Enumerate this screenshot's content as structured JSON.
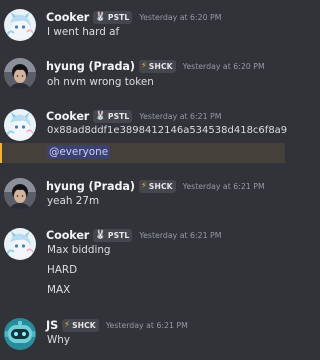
{
  "messages": [
    {
      "author": "Cooker",
      "role_tag": "PSTL",
      "role_icon": "bunny-icon",
      "timestamp": "Yesterday at 6:20 PM",
      "lines": [
        "I went hard af"
      ]
    },
    {
      "author": "hyung (Prada)",
      "role_tag": "SHCK",
      "role_icon": "lightning-icon",
      "timestamp": "Yesterday at 6:20 PM",
      "lines": [
        "oh nvm wrong token"
      ]
    },
    {
      "author": "Cooker",
      "role_tag": "PSTL",
      "role_icon": "bunny-icon",
      "timestamp": "Yesterday at 6:21 PM",
      "lines": [
        "0x88ad8ddf1e3898412146a534538d418c6f8a9"
      ],
      "mention": "@everyone"
    },
    {
      "author": "hyung (Prada)",
      "role_tag": "SHCK",
      "role_icon": "lightning-icon",
      "timestamp": "Yesterday at 6:21 PM",
      "lines": [
        "yeah 27m"
      ]
    },
    {
      "author": "Cooker",
      "role_tag": "PSTL",
      "role_icon": "bunny-icon",
      "timestamp": "Yesterday at 6:21 PM",
      "lines": [
        "Max bidding",
        "HARD",
        "MAX"
      ]
    },
    {
      "author": "JS",
      "role_tag": "SHCK",
      "role_icon": "lightning-icon",
      "timestamp": "Yesterday at 6:21 PM",
      "lines": [
        "Why"
      ]
    }
  ],
  "colors": {
    "background": "#313338",
    "mention_highlight": "#45403a",
    "mention_bar": "#f0b232",
    "mention_pill": "#3c4270"
  }
}
